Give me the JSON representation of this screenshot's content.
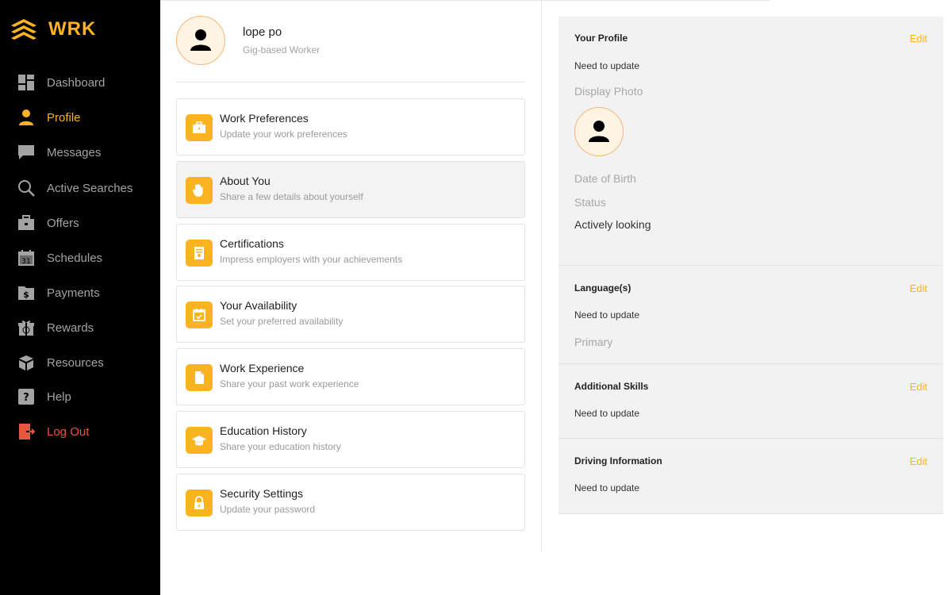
{
  "brand": {
    "name": "WRK",
    "accent": "#fbb321"
  },
  "sidebar": {
    "items": [
      {
        "label": "Dashboard",
        "icon": "dashboard-icon"
      },
      {
        "label": "Profile",
        "icon": "person-icon",
        "active": true
      },
      {
        "label": "Messages",
        "icon": "chat-icon"
      },
      {
        "label": "Active Searches",
        "icon": "search-icon"
      },
      {
        "label": "Offers",
        "icon": "briefcase-icon"
      },
      {
        "label": "Schedules",
        "icon": "calendar-icon",
        "badge": "31"
      },
      {
        "label": "Payments",
        "icon": "dollar-folder-icon",
        "badge": "$"
      },
      {
        "label": "Rewards",
        "icon": "gift-icon"
      },
      {
        "label": "Resources",
        "icon": "boxes-icon"
      },
      {
        "label": "Help",
        "icon": "help-icon",
        "badge": "?"
      },
      {
        "label": "Log Out",
        "icon": "logout-icon",
        "color": "#e5573f"
      }
    ]
  },
  "profile": {
    "name": "lope po",
    "role": "Gig-based Worker"
  },
  "cards": [
    {
      "title": "Work Preferences",
      "subtitle": "Update your work preferences",
      "icon": "briefcase-icon"
    },
    {
      "title": "About You",
      "subtitle": "Share a few details about yourself",
      "icon": "wave-hand-icon",
      "highlighted": true
    },
    {
      "title": "Certifications",
      "subtitle": "Impress employers with your achievements",
      "icon": "certificate-icon"
    },
    {
      "title": "Your Availability",
      "subtitle": "Set your preferred availability",
      "icon": "calendar-check-icon"
    },
    {
      "title": "Work Experience",
      "subtitle": "Share your past work experience",
      "icon": "document-icon"
    },
    {
      "title": "Education History",
      "subtitle": "Share your education history",
      "icon": "graduation-cap-icon"
    },
    {
      "title": "Security Settings",
      "subtitle": "Update your password",
      "icon": "lock-icon"
    }
  ],
  "right": {
    "your_profile": {
      "title": "Your Profile",
      "edit": "Edit",
      "note": "Need to update",
      "display_photo_label": "Display Photo",
      "dob_label": "Date of Birth",
      "status_label": "Status",
      "status_value": "Actively looking"
    },
    "languages": {
      "title": "Language(s)",
      "edit": "Edit",
      "note": "Need to update",
      "primary_label": "Primary"
    },
    "skills": {
      "title": "Additional Skills",
      "edit": "Edit",
      "note": "Need to update"
    },
    "driving": {
      "title": "Driving Information",
      "edit": "Edit",
      "note": "Need to update"
    }
  }
}
